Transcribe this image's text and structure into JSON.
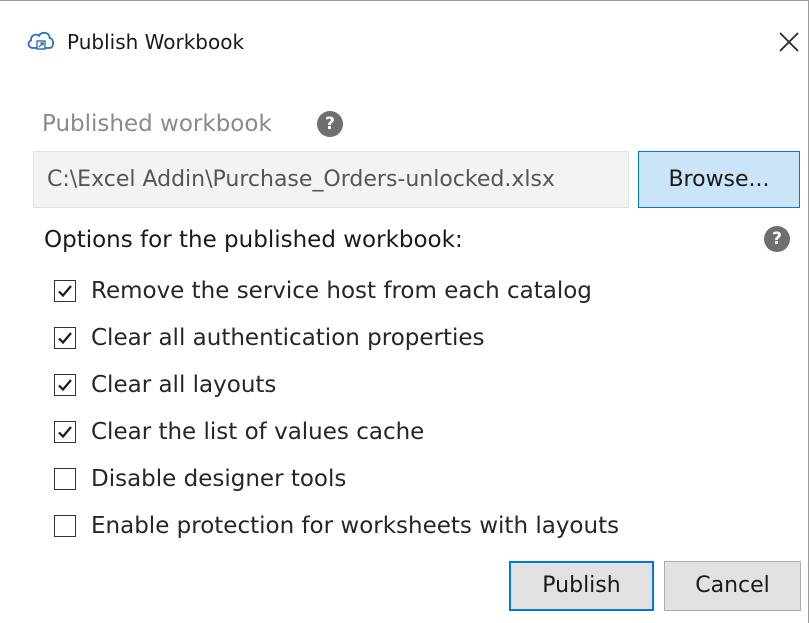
{
  "window": {
    "title": "Publish Workbook"
  },
  "published_workbook": {
    "label": "Published workbook",
    "help": "?",
    "path": "C:\\Excel Addin\\Purchase_Orders-unlocked.xlsx",
    "browse_label": "Browse..."
  },
  "options": {
    "label": "Options for the published workbook:",
    "help": "?",
    "items": [
      {
        "label": "Remove the service host from each catalog",
        "checked": true
      },
      {
        "label": "Clear all authentication properties",
        "checked": true
      },
      {
        "label": "Clear all layouts",
        "checked": true
      },
      {
        "label": "Clear the list of values cache",
        "checked": true
      },
      {
        "label": "Disable designer tools",
        "checked": false
      },
      {
        "label": "Enable protection for worksheets with layouts",
        "checked": false
      }
    ]
  },
  "buttons": {
    "publish": "Publish",
    "cancel": "Cancel"
  },
  "icons": {
    "title": "cloud-publish-icon",
    "close": "close-icon",
    "help": "help-icon",
    "check": "checkmark-icon"
  },
  "colors": {
    "accent": "#0078d7",
    "browse_bg": "#cce4f7",
    "help_bg": "#6f6f6f"
  }
}
